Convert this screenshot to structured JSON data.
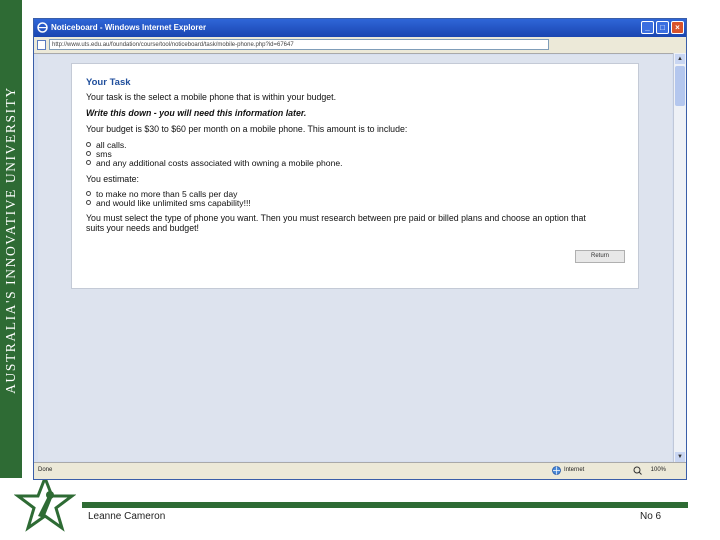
{
  "banner": {
    "text": "AUSTRALIA'S INNOVATIVE UNIVERSITY"
  },
  "browser": {
    "title": "Noticeboard - Windows Internet Explorer",
    "url": "http://www.uts.edu.au/foundation/course/tool/noticeboard/task/mobile-phone.php?id=67647",
    "status": "Done",
    "zone": "Internet",
    "zoom": "100%",
    "buttons": {
      "minimize": "_",
      "maximize": "□",
      "close": "×"
    }
  },
  "task": {
    "title": "Your Task",
    "intro": "Your task is the select a mobile phone that is within your budget.",
    "write_down": "Write this down - you will need this information later.",
    "budget": "Your budget is $30 to $60 per month on a mobile phone. This amount is to include:",
    "includes": [
      "all calls.",
      "sms",
      "and any additional costs associated with owning a mobile phone."
    ],
    "estimate_label": "You estimate:",
    "estimates": [
      "to make no more than 5 calls per day",
      "and would like unlimited sms capability!!!"
    ],
    "instructions_line1": "You must select the type of phone you want. Then you must research between pre paid or billed plans and choose an option that",
    "instructions_line2": "suits your needs and budget!",
    "return_label": "Return"
  },
  "footer": {
    "author": "Leanne Cameron",
    "page": "No 6"
  },
  "colors": {
    "brand_green": "#2e6b34",
    "title_blue": "#1f4e9c",
    "xp_titlebar": "#1a45b0"
  }
}
